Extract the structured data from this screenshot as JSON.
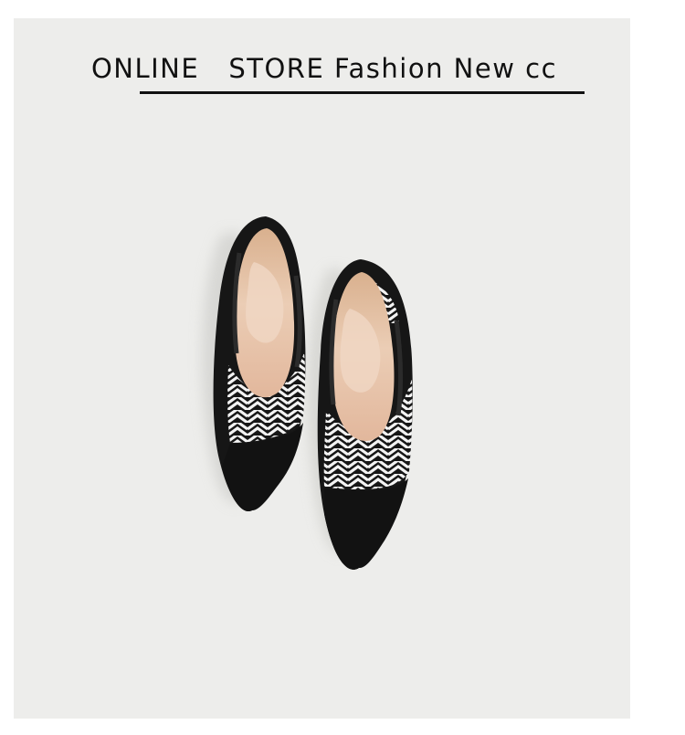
{
  "banner": {
    "title": "ONLINE   STORE Fashion New cc"
  },
  "product_image": {
    "subject": "pair of pointed-toe knit flat shoes",
    "colors": {
      "background": "#ededeb",
      "upper_black": "#161616",
      "pattern_white": "#f2f2f2",
      "insole": "#e3c3a8"
    }
  }
}
